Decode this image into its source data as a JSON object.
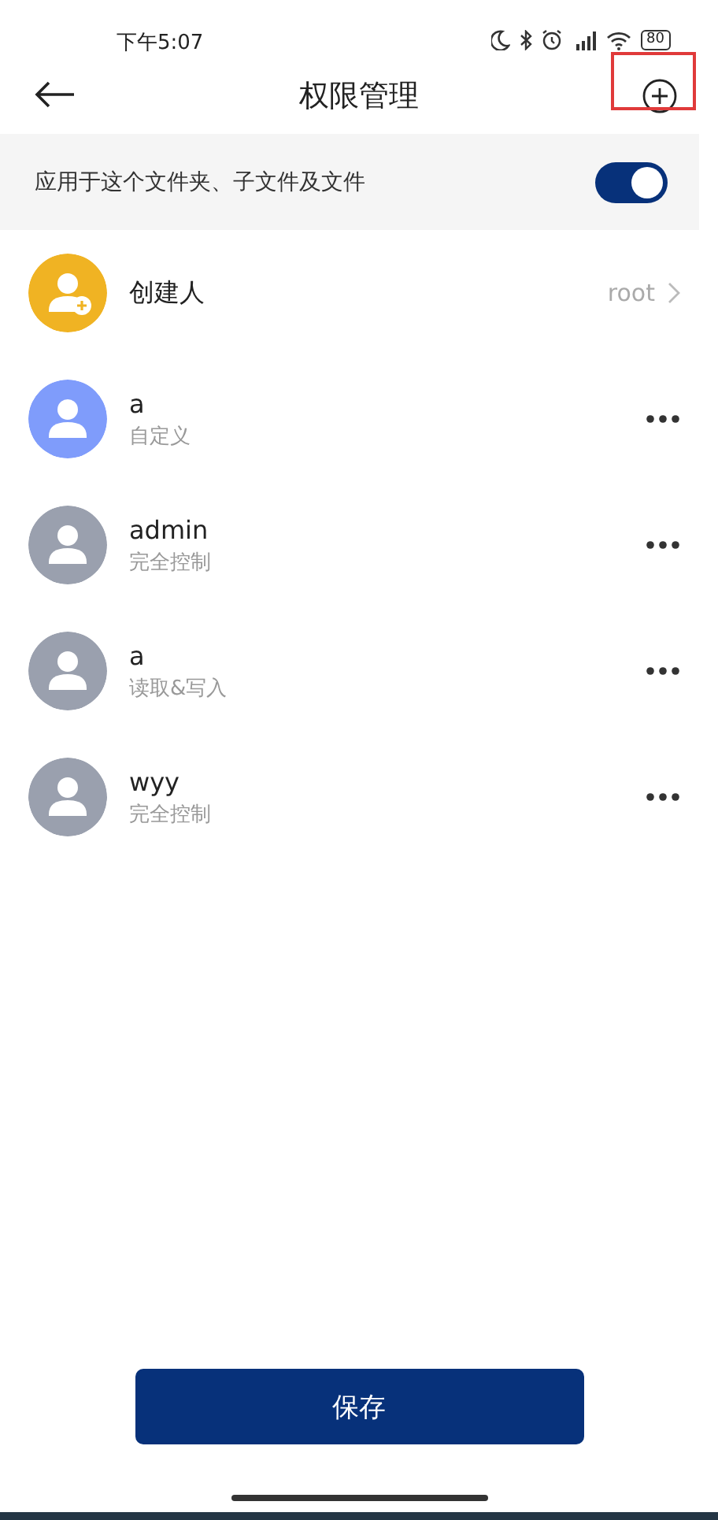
{
  "status_bar": {
    "time": "下午5:07",
    "battery": "80"
  },
  "header": {
    "title": "权限管理",
    "add_highlighted": true
  },
  "apply_option": {
    "label": "应用于这个文件夹、子文件及文件",
    "on": true
  },
  "creator": {
    "label": "创建人",
    "value": "root",
    "color": "#f0b323"
  },
  "users": [
    {
      "name": "a",
      "permission": "自定义",
      "color": "#7f9cfb"
    },
    {
      "name": "admin",
      "permission": "完全控制",
      "color": "#9aa0ae"
    },
    {
      "name": "a",
      "permission": "读取&写入",
      "color": "#9aa0ae"
    },
    {
      "name": "wyy",
      "permission": "完全控制",
      "color": "#9aa0ae"
    }
  ],
  "save_button": "保存"
}
